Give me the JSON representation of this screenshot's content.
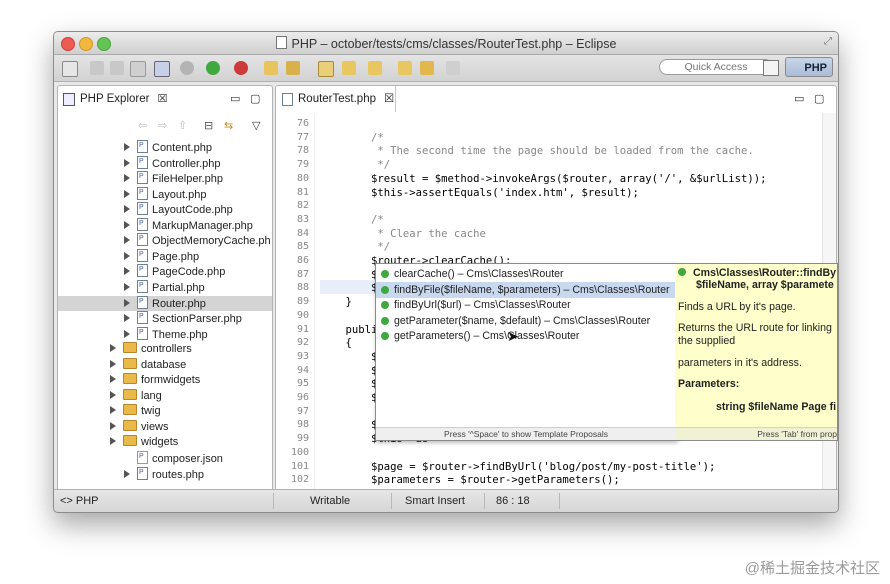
{
  "window": {
    "title": "PHP – october/tests/cms/classes/RouterTest.php – Eclipse"
  },
  "toolbar": {
    "quick_access_placeholder": "Quick Access",
    "perspective_label": "PHP"
  },
  "explorer": {
    "tab_label": "PHP Explorer",
    "close_glyph": "☒",
    "items": [
      {
        "label": "Content.php",
        "type": "file"
      },
      {
        "label": "Controller.php",
        "type": "file"
      },
      {
        "label": "FileHelper.php",
        "type": "file"
      },
      {
        "label": "Layout.php",
        "type": "file"
      },
      {
        "label": "LayoutCode.php",
        "type": "file"
      },
      {
        "label": "MarkupManager.php",
        "type": "file"
      },
      {
        "label": "ObjectMemoryCache.ph",
        "type": "file"
      },
      {
        "label": "Page.php",
        "type": "file"
      },
      {
        "label": "PageCode.php",
        "type": "file"
      },
      {
        "label": "Partial.php",
        "type": "file"
      },
      {
        "label": "Router.php",
        "type": "file",
        "selected": true
      },
      {
        "label": "SectionParser.php",
        "type": "file"
      },
      {
        "label": "Theme.php",
        "type": "file"
      },
      {
        "label": "controllers",
        "type": "folder"
      },
      {
        "label": "database",
        "type": "folder"
      },
      {
        "label": "formwidgets",
        "type": "folder"
      },
      {
        "label": "lang",
        "type": "folder"
      },
      {
        "label": "twig",
        "type": "folder"
      },
      {
        "label": "views",
        "type": "folder"
      },
      {
        "label": "widgets",
        "type": "folder"
      },
      {
        "label": "composer.json",
        "type": "plain"
      },
      {
        "label": "routes.php",
        "type": "file"
      }
    ]
  },
  "editor": {
    "tab_label": "RouterTest.php",
    "lines": [
      {
        "n": "76",
        "text": ""
      },
      {
        "n": "77",
        "text": "        /*"
      },
      {
        "n": "78",
        "text": "         * The second time the page should be loaded from the cache."
      },
      {
        "n": "79",
        "text": "         */"
      },
      {
        "n": "80",
        "text": "        $result = $method->invokeArgs($router, array('/', &$urlList));"
      },
      {
        "n": "81",
        "text": "        $this->assertEquals('index.htm', $result);"
      },
      {
        "n": "82",
        "text": ""
      },
      {
        "n": "83",
        "text": "        /*"
      },
      {
        "n": "84",
        "text": "         * Clear the cache"
      },
      {
        "n": "85",
        "text": "         */"
      },
      {
        "n": "86",
        "text": "        $router->clearCache();"
      },
      {
        "n": "87",
        "text": "        $result ="
      },
      {
        "n": "88",
        "text": "        $this->as"
      },
      {
        "n": "89",
        "text": "    }"
      },
      {
        "n": "90",
        "text": ""
      },
      {
        "n": "91",
        "text": "    public functi"
      },
      {
        "n": "92",
        "text": "    {"
      },
      {
        "n": "93",
        "text": "        $router ="
      },
      {
        "n": "94",
        "text": "        $page = $"
      },
      {
        "n": "95",
        "text": "        $this->as"
      },
      {
        "n": "96",
        "text": "        $this->as"
      },
      {
        "n": "97",
        "text": ""
      },
      {
        "n": "98",
        "text": "        $page = $"
      },
      {
        "n": "99",
        "text": "        $this->as"
      },
      {
        "n": "100",
        "text": ""
      },
      {
        "n": "101",
        "text": "        $page = $router->findByUrl('blog/post/my-post-title');"
      },
      {
        "n": "102",
        "text": "        $parameters = $router->getParameters();"
      }
    ]
  },
  "autocomplete": {
    "items": [
      "clearCache() – Cms\\Classes\\Router",
      "findByFile($fileName, $parameters) – Cms\\Classes\\Router",
      "findByUrl($url) – Cms\\Classes\\Router",
      "getParameter($name, $default) – Cms\\Classes\\Router",
      "getParameters() – Cms\\Classes\\Router"
    ],
    "selected_index": 1,
    "footer": "Press '^Space' to show Template Proposals"
  },
  "doc": {
    "head1": "Cms\\Classes\\Router::findBy",
    "head2": "$fileName, array $paramete",
    "p1": "Finds a URL by it's page.",
    "p2": "Returns the URL route for linking",
    "p3": "the supplied",
    "p4": "parameters in it's address.",
    "p5": "Parameters:",
    "p6": "string $fileName Page fi",
    "footer": "Press 'Tab' from prop"
  },
  "status": {
    "left": "<> PHP",
    "writable": "Writable",
    "insert_mode": "Smart Insert",
    "position": "86 : 18"
  },
  "watermark": "@稀土掘金技术社区",
  "colors": {
    "selection": "#c7d8ef",
    "doc_bg": "#ffffcc",
    "method_dot": "#3fa83f"
  }
}
